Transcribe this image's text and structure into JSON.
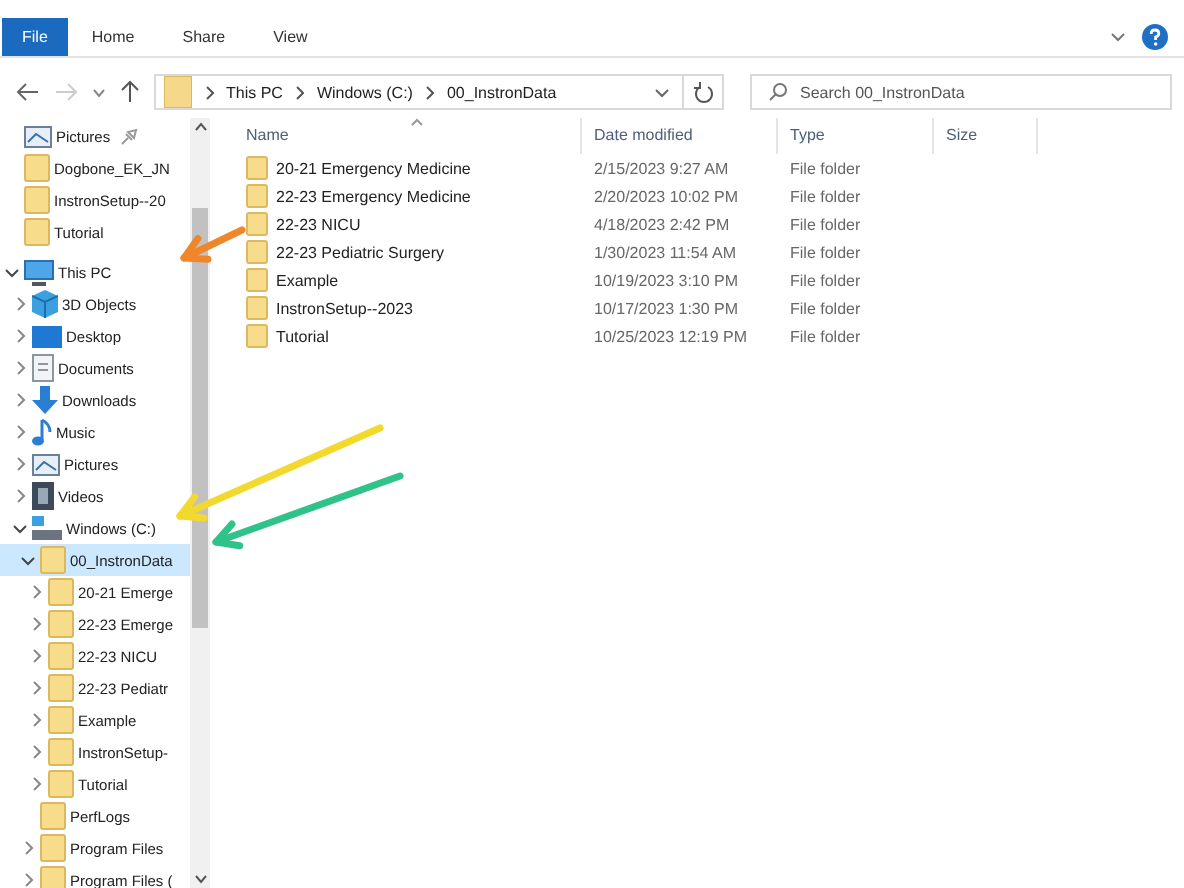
{
  "ribbon": {
    "tabs": [
      {
        "label": "File",
        "selected": true
      },
      {
        "label": "Home",
        "selected": false
      },
      {
        "label": "Share",
        "selected": false
      },
      {
        "label": "View",
        "selected": false
      }
    ]
  },
  "address": {
    "path": [
      "This PC",
      "Windows (C:)",
      "00_InstronData"
    ]
  },
  "search": {
    "placeholder": "Search 00_InstronData"
  },
  "nav": {
    "items": [
      {
        "label": "Pictures",
        "kind": "pictures",
        "pinned": true,
        "selected": false
      },
      {
        "label": "Dogbone_EK_JN",
        "kind": "folder",
        "selected": false
      },
      {
        "label": "InstronSetup--20",
        "kind": "folder",
        "selected": false
      },
      {
        "label": "Tutorial",
        "kind": "folder",
        "selected": false
      },
      {
        "label": "This PC",
        "kind": "pc",
        "expanded": true,
        "selected": false,
        "children": [
          {
            "label": "3D Objects",
            "kind": "cube",
            "expanded": false,
            "selected": false
          },
          {
            "label": "Desktop",
            "kind": "desktop",
            "expanded": false,
            "selected": false
          },
          {
            "label": "Documents",
            "kind": "documents",
            "expanded": false,
            "selected": false
          },
          {
            "label": "Downloads",
            "kind": "downloads",
            "expanded": false,
            "selected": false
          },
          {
            "label": "Music",
            "kind": "music",
            "expanded": false,
            "selected": false
          },
          {
            "label": "Pictures",
            "kind": "pictures",
            "expanded": false,
            "selected": false
          },
          {
            "label": "Videos",
            "kind": "videos",
            "expanded": false,
            "selected": false
          },
          {
            "label": "Windows (C:)",
            "kind": "drive",
            "expanded": true,
            "selected": false,
            "children": [
              {
                "label": "00_InstronData",
                "kind": "folder",
                "expanded": true,
                "selected": true,
                "children": [
                  {
                    "label": "20-21 Emerge",
                    "kind": "folder",
                    "expanded": false,
                    "selected": false
                  },
                  {
                    "label": "22-23 Emerge",
                    "kind": "folder",
                    "expanded": false,
                    "selected": false
                  },
                  {
                    "label": "22-23 NICU",
                    "kind": "folder",
                    "expanded": false,
                    "selected": false
                  },
                  {
                    "label": "22-23 Pediatr",
                    "kind": "folder",
                    "expanded": false,
                    "selected": false
                  },
                  {
                    "label": "Example",
                    "kind": "folder",
                    "expanded": false,
                    "selected": false
                  },
                  {
                    "label": "InstronSetup-",
                    "kind": "folder",
                    "expanded": false,
                    "selected": false
                  },
                  {
                    "label": "Tutorial",
                    "kind": "folder",
                    "expanded": false,
                    "selected": false
                  }
                ]
              },
              {
                "label": "PerfLogs",
                "kind": "folder",
                "selected": false
              },
              {
                "label": "Program Files",
                "kind": "folder",
                "expanded": false,
                "selected": false
              },
              {
                "label": "Program Files (",
                "kind": "folder",
                "expanded": false,
                "selected": false
              }
            ]
          }
        ]
      }
    ]
  },
  "table": {
    "columns": [
      "Name",
      "Date modified",
      "Type",
      "Size"
    ],
    "rows": [
      {
        "name": "20-21 Emergency Medicine",
        "date": "2/15/2023 9:27 AM",
        "type": "File folder"
      },
      {
        "name": "22-23 Emergency Medicine",
        "date": "2/20/2023 10:02 PM",
        "type": "File folder"
      },
      {
        "name": "22-23 NICU",
        "date": "4/18/2023 2:42 PM",
        "type": "File folder"
      },
      {
        "name": "22-23 Pediatric Surgery",
        "date": "1/30/2023 11:54 AM",
        "type": "File folder"
      },
      {
        "name": "Example",
        "date": "10/19/2023 3:10 PM",
        "type": "File folder"
      },
      {
        "name": "InstronSetup--2023",
        "date": "10/17/2023 1:30 PM",
        "type": "File folder"
      },
      {
        "name": "Tutorial",
        "date": "10/25/2023 12:19 PM",
        "type": "File folder"
      }
    ]
  },
  "annotations": [
    {
      "kind": "arrow",
      "color": "#f0862a"
    },
    {
      "kind": "arrow",
      "color": "#f3d92e"
    },
    {
      "kind": "arrow",
      "color": "#2fc38a"
    }
  ]
}
